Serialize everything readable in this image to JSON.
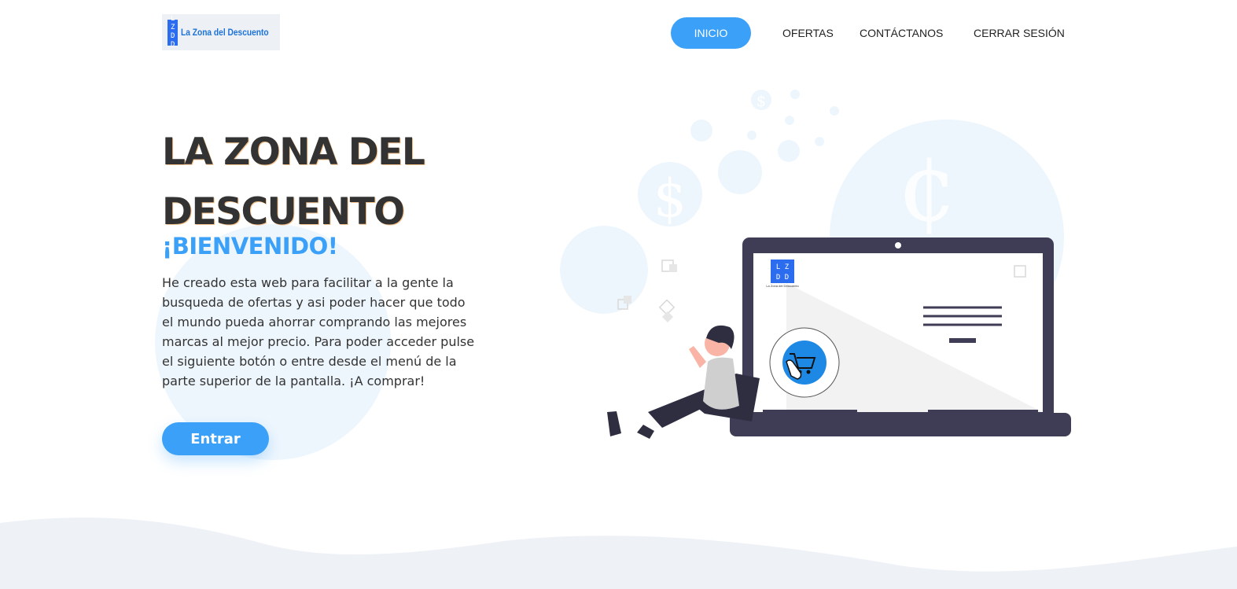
{
  "header": {
    "logo_mark_line1": "L Z",
    "logo_mark_line2": "D D",
    "logo_text": "La Zona del Descuento",
    "nav": [
      {
        "label": "INICIO",
        "active": true
      },
      {
        "label": "OFERTAS",
        "active": false
      },
      {
        "label": "CONTÁCTANOS",
        "active": false
      },
      {
        "label": "CERRAR SESIÓN",
        "active": false
      }
    ]
  },
  "hero": {
    "title": "LA ZONA DEL DESCUENTO",
    "subtitle": "¡BIENVENIDO!",
    "description": "He creado esta web para facilitar a la gente la busqueda de ofertas y asi poder hacer que todo el mundo pueda ahorrar comprando las mejores marcas al mejor precio. Para poder acceder pulse el siguiente botón o entre desde el menú de la parte superior de la pantalla. ¡A comprar!",
    "button_label": "Entrar"
  },
  "illustration": {
    "screen_logo_line1": "L Z",
    "screen_logo_line2": "D D",
    "screen_logo_caption": "La Zona del Descuento",
    "coin_symbol": "$",
    "cent_symbol": "¢"
  },
  "colors": {
    "accent": "#3aa0f8",
    "title": "#333333",
    "laptop": "#3f3d56",
    "blob": "#eef6fd"
  }
}
